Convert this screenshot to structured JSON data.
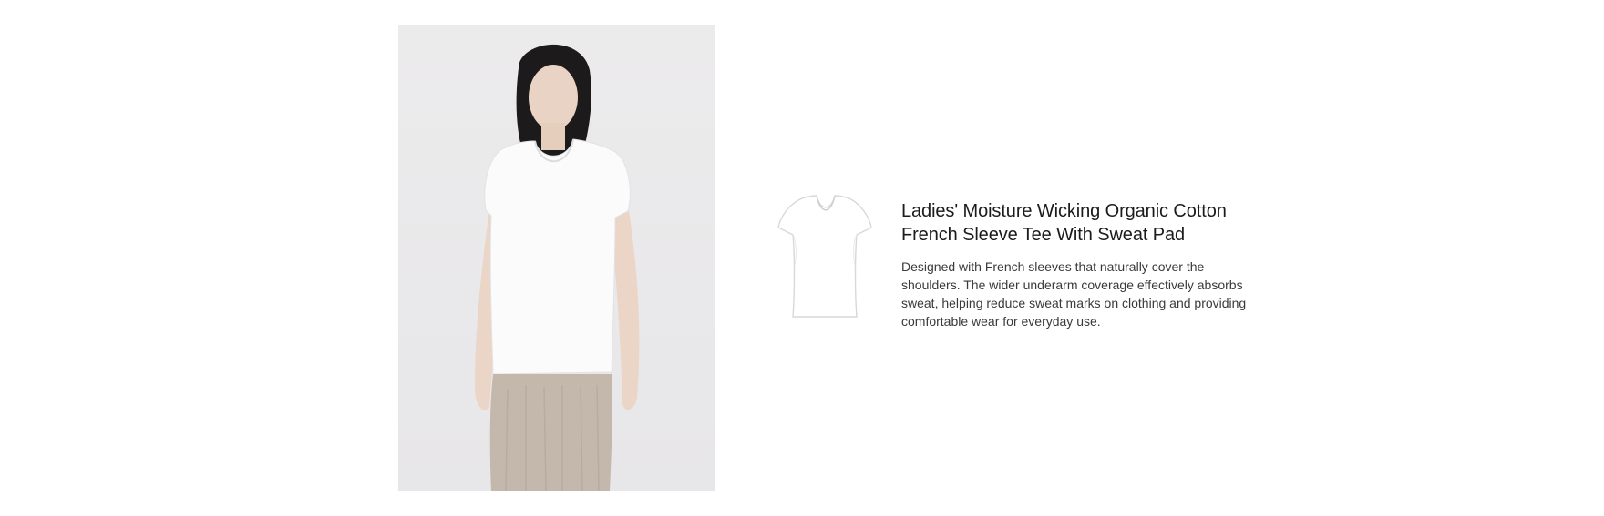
{
  "product": {
    "title": "Ladies' Moisture Wicking Organic Cotton French Sleeve Tee With Sweat Pad",
    "description": "Designed with French sleeves that naturally cover the shoulders. The wider underarm coverage effectively absorbs sweat, helping reduce sweat marks on clothing and providing comfortable wear for everyday use."
  },
  "colors": {
    "background": "#ffffff",
    "photo_background": "#ebeaec",
    "title_text": "#1b1b1b",
    "body_text": "#3a3a3a"
  }
}
